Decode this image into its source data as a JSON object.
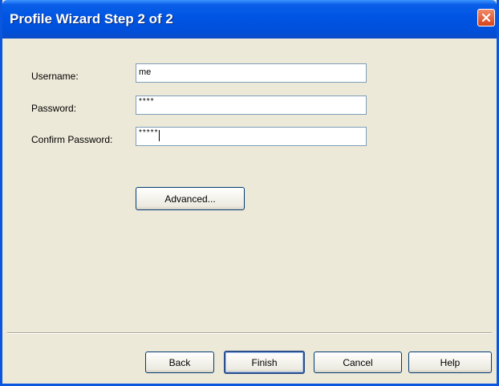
{
  "window": {
    "title": "Profile Wizard Step 2 of 2",
    "colors": {
      "titlebar": "#0054E3",
      "frame": "#0A56DE",
      "close": "#D8431C",
      "face": "#ECE9D8"
    }
  },
  "form": {
    "username": {
      "label": "Username:",
      "value": "me"
    },
    "password": {
      "label": "Password:",
      "value": "****"
    },
    "confirm_password": {
      "label": "Confirm Password:",
      "value": "*****"
    }
  },
  "buttons": {
    "advanced": "Advanced...",
    "back": "Back",
    "finish": "Finish",
    "cancel": "Cancel",
    "help": "Help"
  },
  "icons": {
    "close": "close-icon"
  }
}
